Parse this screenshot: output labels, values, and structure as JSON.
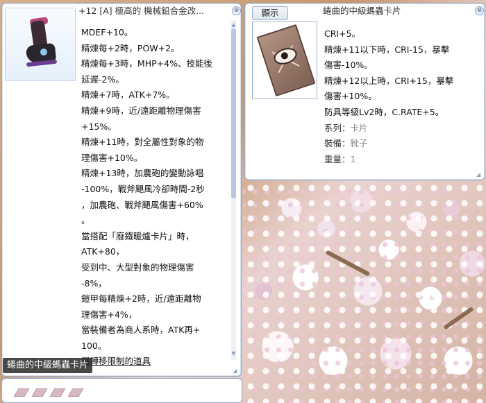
{
  "left_window": {
    "title": "+12 [A] 極高的 機械鉛合金改...",
    "close": "⊗",
    "icon": "boots-icon",
    "lines": [
      "MDEF+10。",
      "精煉每+2時，POW+2。",
      "精煉每+3時，MHP+4%、技能後",
      "延遲-2%。",
      "精煉+7時，ATK+7%。",
      "精煉+9時，近/遠距離物理傷害",
      "+15%。",
      "精煉+11時，對全屬性對象的物",
      "理傷害+10%。",
      "精煉+13時，加農砲的變動詠唱",
      "-100%，戰斧颶風冷卻時間-2秒",
      "，加農砲、戰斧颶風傷害+60%",
      "。",
      "當搭配「廢鐵暖爐卡片」時，",
      "ATK+80，",
      "受到中、大型對象的物理傷害",
      "-8%，",
      "鎧甲每精煉+2時，近/遠距離物",
      "理傷害+4%，",
      "當裝備者為商人系時，ATK再+",
      "100。",
      "屬轉移限制的道具"
    ]
  },
  "right_window": {
    "tab": "顯示",
    "title": "蜷曲的中級螞蟲卡片",
    "close": "⊗",
    "icon": "card-eye-icon",
    "lines": [
      "CRI+5。",
      "精煉+11以下時，CRI-15，暴擊",
      "傷害-10%。",
      "精煉+12以上時，CRI+15，暴擊",
      "傷害+10%。",
      "防具等級Lv2時，C.RATE+5。"
    ],
    "meta": [
      {
        "label": "系列",
        "value": "卡片"
      },
      {
        "label": "裝備",
        "value": "靴子"
      },
      {
        "label": "重量",
        "value": "1"
      }
    ],
    "meta_sep": "："
  },
  "hover_tag": "蜷曲的中級螞蟲卡片",
  "colors": {
    "window_border": "#8fa7c8",
    "meta_value": "#8a8a8a",
    "tag_bg": "#282828"
  }
}
